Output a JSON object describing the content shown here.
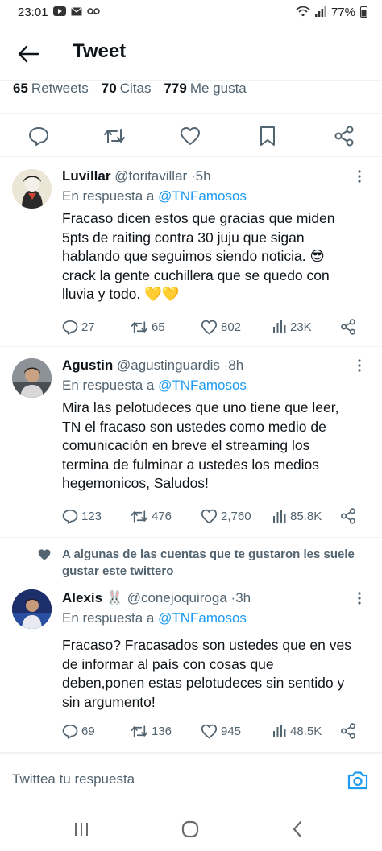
{
  "status_bar": {
    "time": "23:01",
    "battery": "77%"
  },
  "header": {
    "title": "Tweet"
  },
  "stats": {
    "retweets_count": "65",
    "retweets_label": "Retweets",
    "quotes_count": "70",
    "quotes_label": "Citas",
    "likes_count": "779",
    "likes_label": "Me gusta"
  },
  "replies": [
    {
      "name": "Luvillar",
      "handle": "@toritavillar",
      "time": "5h",
      "reply_to_label": "En respuesta a",
      "reply_to_mention": "@TNFamosos",
      "text": "Fracaso dicen estos que gracias que miden\n5pts de raiting contra 30 juju que sigan\nhablando que seguimos siendo noticia. 😎\ncrack la gente cuchillera que se quedo con\nlluvia y todo. 💛💛",
      "replies": "27",
      "retweets": "65",
      "likes": "802",
      "views": "23K"
    },
    {
      "name": "Agustin",
      "handle": "@agustinguardis",
      "time": "8h",
      "reply_to_label": "En respuesta a",
      "reply_to_mention": "@TNFamosos",
      "text": "Mira las pelotudeces que uno tiene que leer,\nTN el fracaso son ustedes como medio de\ncomunicación en breve el streaming los\ntermina de fulminar a ustedes los medios\nhegemonicos, Saludos!",
      "replies": "123",
      "retweets": "476",
      "likes": "2,760",
      "views": "85.8K"
    },
    {
      "name": "Alexis 🐰",
      "handle": "@conejoquiroga",
      "time": "3h",
      "reply_to_label": "En respuesta a",
      "reply_to_mention": "@TNFamosos",
      "text": "Fracaso? Fracasados son ustedes que en ves\nde informar al país con cosas que\ndeben,ponen estas pelotudeces sin sentido y\nsin argumento!",
      "replies": "69",
      "retweets": "136",
      "likes": "945",
      "views": "48.5K"
    }
  ],
  "social_context": {
    "text": "A algunas de las cuentas que te gustaron les suele gustar este twittero"
  },
  "compose": {
    "placeholder": "Twittea tu respuesta"
  },
  "colors": {
    "accent": "#1d9bf0",
    "secondary_text": "#536471",
    "primary_text": "#0f1419",
    "divider": "#eff3f4"
  }
}
